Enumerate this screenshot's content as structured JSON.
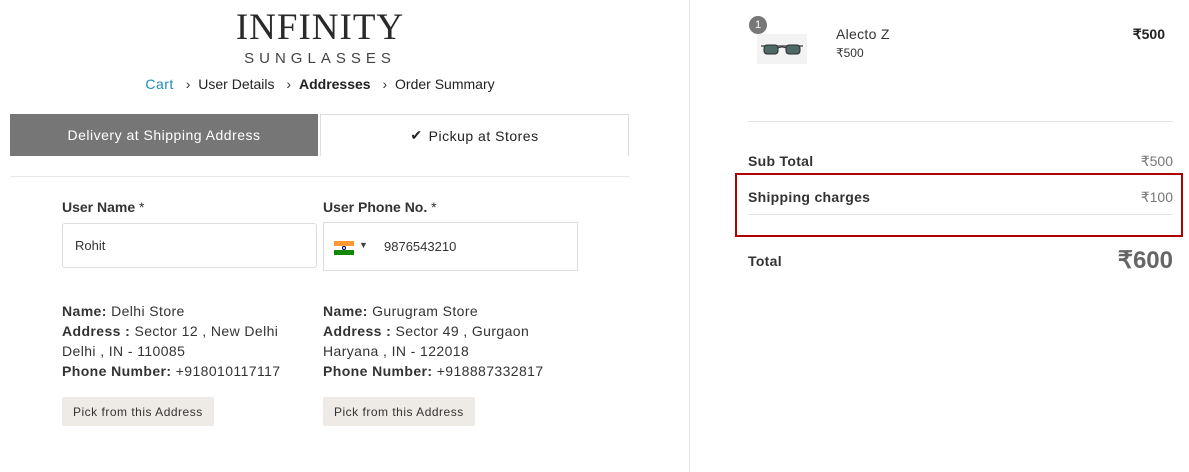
{
  "brand": {
    "name": "INFINITY",
    "tagline": "SUNGLASSES"
  },
  "breadcrumb": [
    {
      "label": "Cart",
      "state": "link"
    },
    {
      "label": "User Details",
      "state": "normal"
    },
    {
      "label": "Addresses",
      "state": "active"
    },
    {
      "label": "Order Summary",
      "state": "normal"
    }
  ],
  "breadcrumb_separator": "›",
  "tabs": {
    "delivery": "Delivery at Shipping Address",
    "pickup_check": "✔",
    "pickup": "Pickup at Stores"
  },
  "form": {
    "user_name_label": "User Name",
    "user_name_required": "*",
    "user_name_value": "Rohit",
    "phone_label": "User Phone No.",
    "phone_required": "*",
    "phone_country_icon": "india-flag-icon",
    "phone_value": "9876543210"
  },
  "stores": [
    {
      "name_label": "Name:",
      "name": "Delhi Store",
      "address_label": "Address :",
      "address_line1": "Sector 12 , New Delhi",
      "address_line2": "Delhi , IN - 110085",
      "phone_label": "Phone Number:",
      "phone": "+918010117117",
      "button": "Pick from this Address"
    },
    {
      "name_label": "Name:",
      "name": "Gurugram Store",
      "address_label": "Address :",
      "address_line1": "Sector 49 , Gurgaon",
      "address_line2": "Haryana , IN - 122018",
      "phone_label": "Phone Number:",
      "phone": "+918887332817",
      "button": "Pick from this Address"
    }
  ],
  "cart": {
    "items": [
      {
        "quantity": "1",
        "name": "Alecto Z",
        "unit_price": "₹500",
        "price": "₹500",
        "image_icon": "sunglasses-thumbnail"
      }
    ],
    "subtotal_label": "Sub Total",
    "subtotal": "₹500",
    "shipping_label": "Shipping charges",
    "shipping": "₹100",
    "total_label": "Total",
    "total": "₹600"
  },
  "colors": {
    "link": "#1a8fb5",
    "tab_active_bg": "#767676",
    "button_bg": "#eeeae6",
    "highlight_border": "#b00000"
  }
}
